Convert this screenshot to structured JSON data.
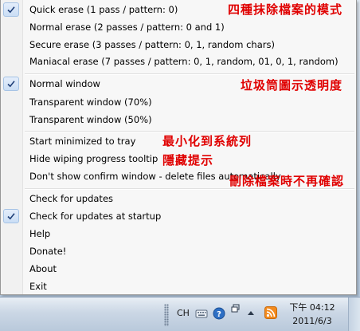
{
  "menu": {
    "erase_group": [
      {
        "label": "Quick erase (1 pass / pattern: 0)",
        "checked": true
      },
      {
        "label": "Normal erase (2 passes / pattern: 0 and 1)",
        "checked": false
      },
      {
        "label": "Secure erase (3 passes / pattern: 0, 1, random chars)",
        "checked": false
      },
      {
        "label": "Maniacal erase (7 passes / pattern: 0, 1, random, 01, 0, 1, random)",
        "checked": false
      }
    ],
    "window_group": [
      {
        "label": "Normal window",
        "checked": true
      },
      {
        "label": "Transparent window (70%)",
        "checked": false
      },
      {
        "label": "Transparent window (50%)",
        "checked": false
      }
    ],
    "options_group": [
      {
        "label": "Start minimized to tray",
        "checked": false
      },
      {
        "label": "Hide wiping progress tooltip",
        "checked": false
      },
      {
        "label": "Don't show confirm window - delete files automatically",
        "checked": false
      }
    ],
    "misc_group": [
      {
        "label": "Check for updates",
        "checked": false
      },
      {
        "label": "Check for updates at startup",
        "checked": true
      },
      {
        "label": "Help",
        "checked": false
      },
      {
        "label": "Donate!",
        "checked": false
      },
      {
        "label": "About",
        "checked": false
      },
      {
        "label": "Exit",
        "checked": false
      }
    ]
  },
  "annotations": {
    "erase_modes": "四種抹除檔案的模式",
    "transparency": "垃圾筒圖示透明度",
    "minimize_tray": "最小化到系統列",
    "hide_tooltip": "隱藏提示",
    "no_confirm": "刪除檔案時不再確認"
  },
  "taskbar": {
    "language": "CH",
    "time": "下午 04:12",
    "date": "2011/6/3"
  },
  "colors": {
    "annotation": "#e00000",
    "check_bg": "#cadef5",
    "menu_bg": "#f7f7f7"
  }
}
